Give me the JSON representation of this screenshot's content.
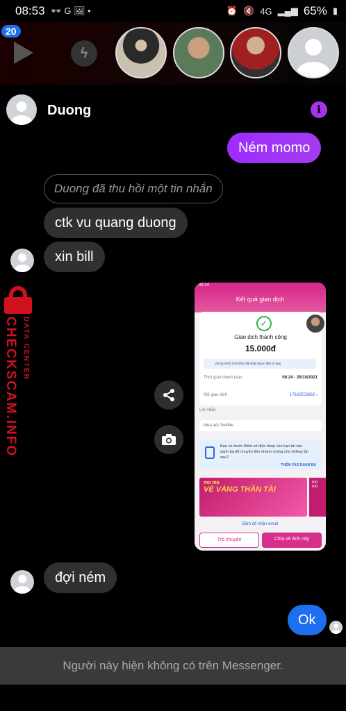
{
  "status_bar": {
    "time": "08:53",
    "left_icons": "👓 G 🖼 •",
    "network": "4G",
    "battery": "65%"
  },
  "stories": {
    "badge_count": "20"
  },
  "header": {
    "contact_name": "Duong",
    "info_icon": "i"
  },
  "messages": {
    "outgoing_1": "Ném momo",
    "recalled_notice": "Duong đã thu hồi một tin nhắn",
    "incoming_1": "ctk vu quang duong",
    "incoming_2": "xin bill",
    "incoming_3": "đợi ném",
    "outgoing_2": "Ok"
  },
  "watermark": {
    "main": "CHECKSCAM.INFO",
    "sub": "DATA CENTER"
  },
  "shared_image": {
    "status_time": "08:24",
    "header_title": "Kết quả giao dịch",
    "status_title": "Giao dịch thành công",
    "amount": "15.000đ",
    "note": "VŨ QUANG DƯƠNG đã nhận được tiền từ bạn",
    "time_label": "Thời gian thanh toán",
    "time_value": "08:24 - 20/10/2021",
    "code_label": "Mã giao dịch",
    "code_value": "17662553862 ›",
    "message_label": "Lời nhắn",
    "message_value": "Mua acc freefire",
    "contact_prompt": "Bạn có muốn thêm số điện thoại của bạn bè vào danh bạ để chuyển tiền nhanh chóng cho những lần sau?",
    "contact_link": "THÊM VÀO DANH BẠ",
    "banner_brand": "mo mo",
    "banner_title": "VÉ VÀNG THẦN TÀI",
    "banner2_brand": "mo mo",
    "email_link": "Bấm để nhận email",
    "btn_chat": "Trò chuyện",
    "btn_share": "Chia sẻ ảnh này"
  },
  "footer": {
    "unavailable_text": "Người này hiện không có trên Messenger."
  }
}
